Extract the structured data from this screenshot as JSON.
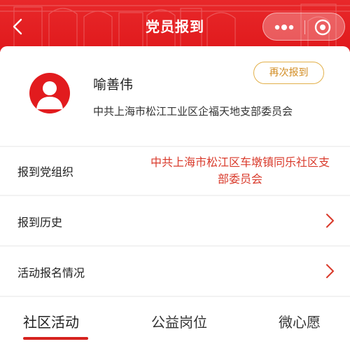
{
  "header": {
    "title": "党员报到",
    "back_icon": "chevron-left-icon",
    "more_icon": "more-dots-icon",
    "close_icon": "target-close-icon",
    "color": "#e21b1e"
  },
  "profile": {
    "name": "喻善伟",
    "organization": "中共上海市松江工业区企福天地支部委员会",
    "rereport_label": "再次报到",
    "avatar_icon": "person-avatar-icon"
  },
  "rows": [
    {
      "label": "报到党组织",
      "value_line1": "中共上海市松江区车墩镇同乐社区支",
      "value_line2": "部委员会"
    },
    {
      "label": "报到历史",
      "icon": "chevron-right-icon"
    },
    {
      "label": "活动报名情况",
      "icon": "chevron-right-icon"
    }
  ],
  "tabs": [
    {
      "label": "社区活动",
      "active": true
    },
    {
      "label": "公益岗位",
      "active": false
    },
    {
      "label": "微心愿",
      "active": false
    }
  ],
  "colors": {
    "accent": "#e21b1e",
    "value_text": "#d93a2b",
    "button_border": "#e2b04a",
    "button_text": "#d28c22"
  }
}
